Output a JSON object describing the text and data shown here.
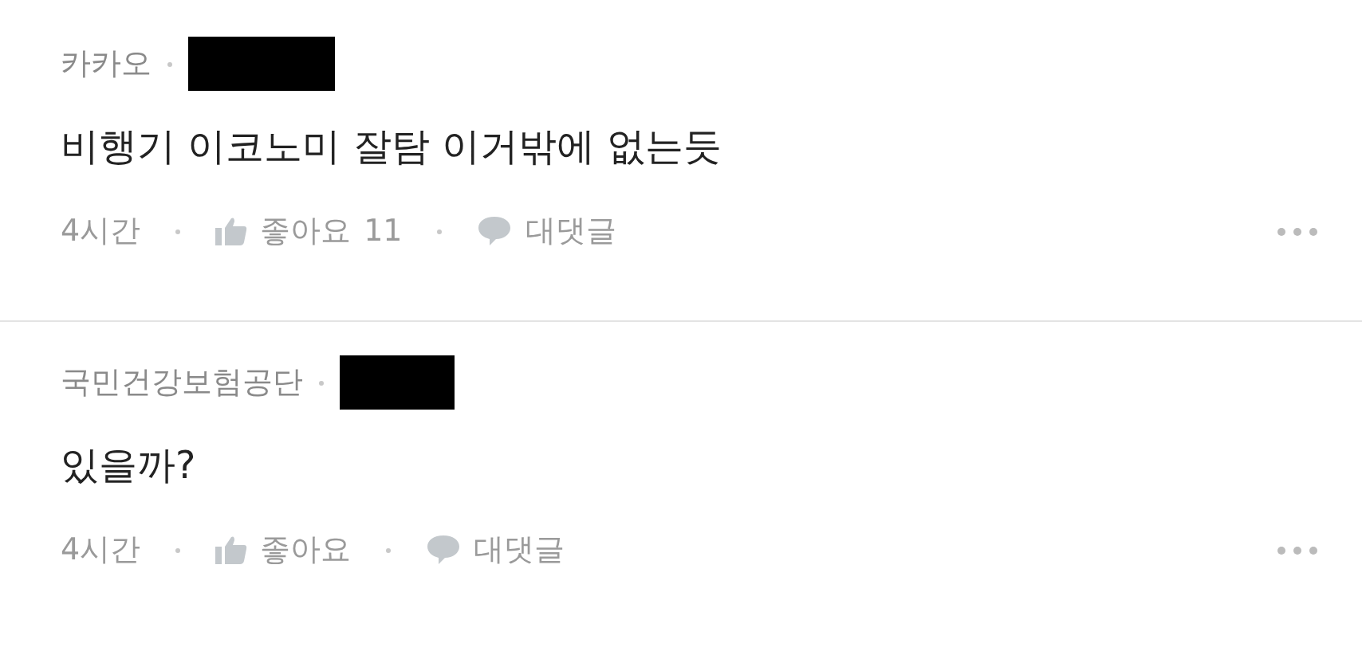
{
  "comments": [
    {
      "author": "카카오",
      "text": "비행기 이코노미 잘탐 이거밖에 없는듯",
      "time": "4시간",
      "like_label": "좋아요",
      "like_count": "11",
      "reply_label": "대댓글"
    },
    {
      "author": "국민건강보험공단",
      "text": "있을까?",
      "time": "4시간",
      "like_label": "좋아요",
      "reply_label": "대댓글"
    }
  ]
}
